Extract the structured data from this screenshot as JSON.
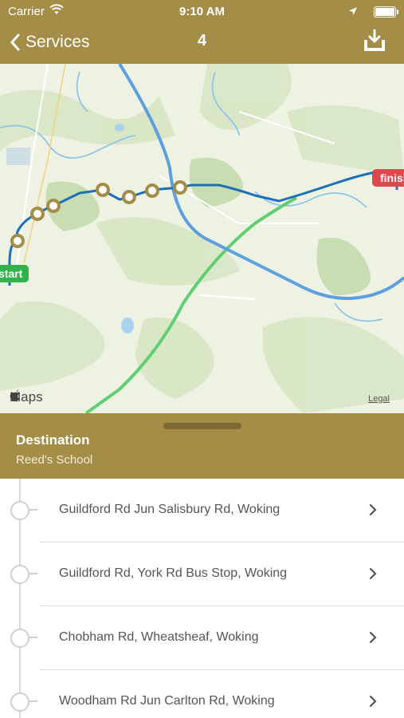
{
  "status_bar": {
    "carrier": "Carrier",
    "time": "9:10 AM"
  },
  "nav": {
    "back_label": "Services",
    "title": "4"
  },
  "map": {
    "start_label": "start",
    "finish_label": "finish",
    "attribution": "Maps",
    "legal": "Legal"
  },
  "destination": {
    "title": "Destination",
    "value": "Reed's School"
  },
  "stops": [
    {
      "name": "Guildford Rd Jun Salisbury Rd, Woking"
    },
    {
      "name": "Guildford Rd, York Rd Bus Stop, Woking"
    },
    {
      "name": "Chobham Rd, Wheatsheaf, Woking"
    },
    {
      "name": "Woodham Rd Jun Carlton Rd, Woking"
    }
  ],
  "colors": {
    "accent": "#a48d47",
    "route": "#1d6fb8",
    "start": "#2fb34a",
    "finish": "#e0474c"
  }
}
